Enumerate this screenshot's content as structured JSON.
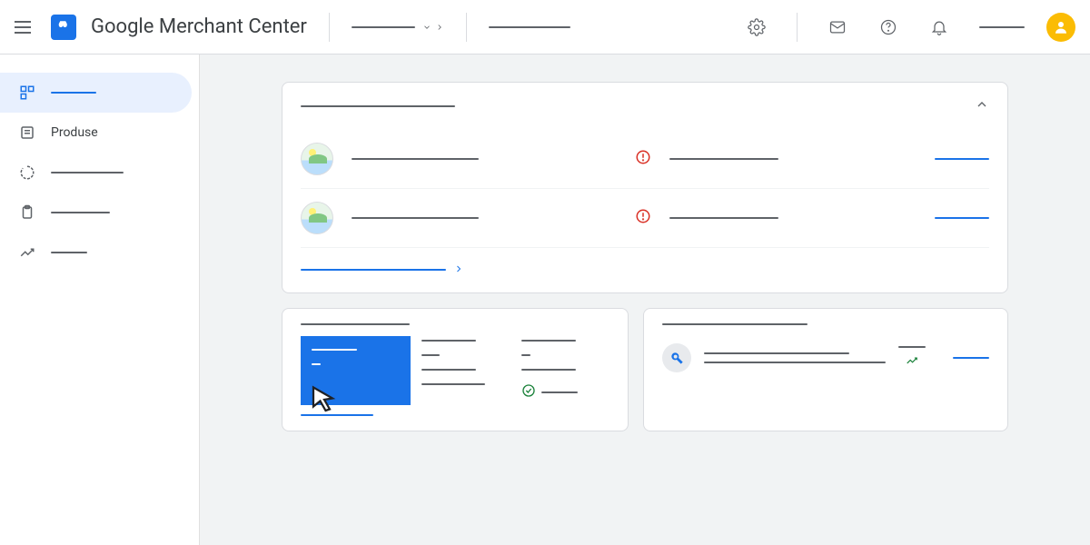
{
  "header": {
    "app_title": "Google Merchant Center",
    "icons": {
      "menu": "menu-icon",
      "settings": "gear-icon",
      "mail": "mail-icon",
      "help": "help-icon",
      "notifications": "bell-icon",
      "avatar": "avatar-icon"
    }
  },
  "sidebar": {
    "items": [
      {
        "id": "overview",
        "label_placeholder": true,
        "active": true,
        "icon": "dashboard-icon"
      },
      {
        "id": "products",
        "label": "Produse",
        "active": false,
        "icon": "list-icon"
      },
      {
        "id": "item3",
        "label_placeholder": true,
        "active": false,
        "icon": "circle-icon"
      },
      {
        "id": "item4",
        "label_placeholder": true,
        "active": false,
        "icon": "clipboard-icon"
      },
      {
        "id": "item5",
        "label_placeholder": true,
        "active": false,
        "icon": "trend-icon"
      }
    ]
  },
  "main": {
    "card1": {
      "title_placeholder": true,
      "rows": [
        {
          "alert": true,
          "link": true
        },
        {
          "alert": true,
          "link": true
        }
      ],
      "footer_link_placeholder": true
    },
    "card2": {
      "title_placeholder": true,
      "highlighted_col": 0,
      "cursor_overlay": true
    },
    "card3": {
      "title_placeholder": true,
      "suggestion": {
        "icon": "wrench-icon",
        "trend": "up",
        "link": true
      }
    }
  },
  "colors": {
    "primary": "#1a73e8",
    "error": "#d93025",
    "success": "#188038",
    "accent_avatar": "#fbbc04"
  }
}
